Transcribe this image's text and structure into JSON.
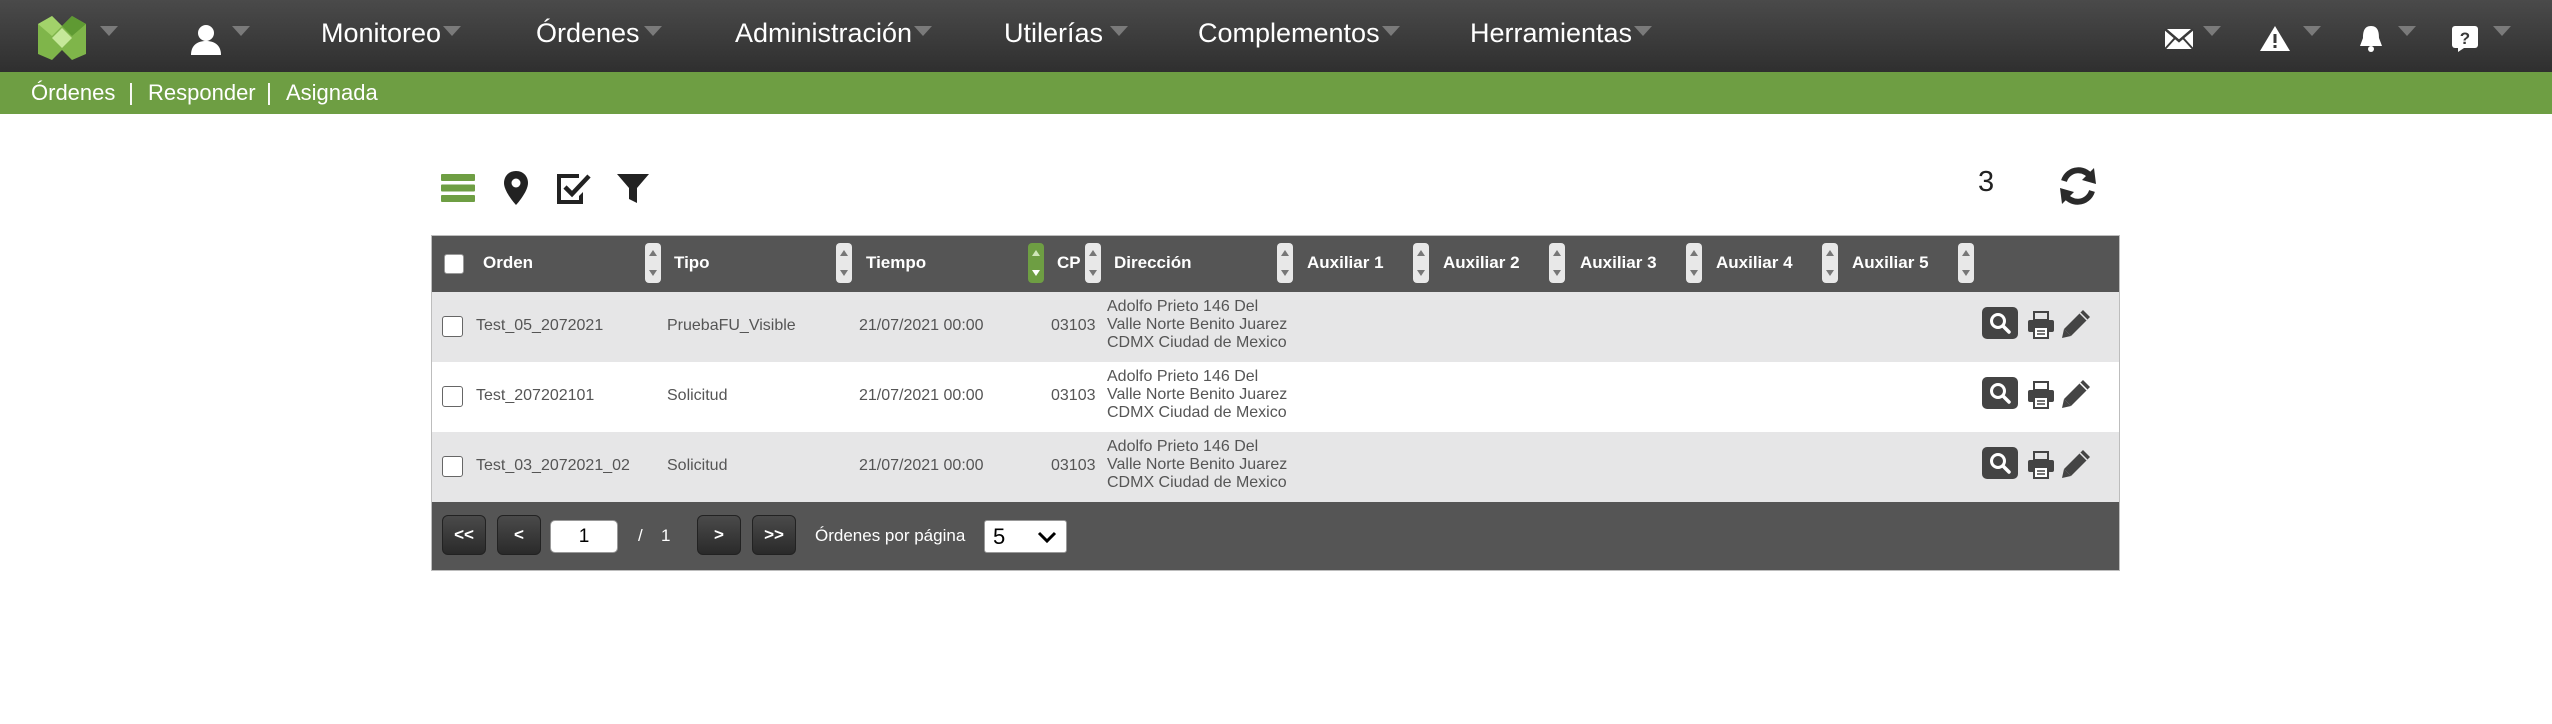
{
  "nav": {
    "menu": [
      "Monitoreo",
      "Órdenes",
      "Administración",
      "Utilerías",
      "Complementos",
      "Herramientas"
    ]
  },
  "breadcrumb": [
    "Órdenes",
    "Responder",
    "Asignada"
  ],
  "toolbar": {
    "record_count": "3"
  },
  "table": {
    "columns": [
      "Orden",
      "Tipo",
      "Tiempo",
      "CP",
      "Dirección",
      "Auxiliar 1",
      "Auxiliar 2",
      "Auxiliar 3",
      "Auxiliar 4",
      "Auxiliar 5"
    ],
    "rows": [
      {
        "orden": "Test_05_2072021",
        "tipo": "PruebaFU_Visible",
        "tiempo": "21/07/2021 00:00",
        "cp": "03103",
        "direccion": [
          "Adolfo Prieto 146 Del",
          "Valle Norte Benito Juarez",
          "CDMX Ciudad de Mexico"
        ]
      },
      {
        "orden": "Test_207202101",
        "tipo": "Solicitud",
        "tiempo": "21/07/2021 00:00",
        "cp": "03103",
        "direccion": [
          "Adolfo Prieto 146 Del",
          "Valle Norte Benito Juarez",
          "CDMX Ciudad de Mexico"
        ]
      },
      {
        "orden": "Test_03_2072021_02",
        "tipo": "Solicitud",
        "tiempo": "21/07/2021 00:00",
        "cp": "03103",
        "direccion": [
          "Adolfo Prieto 146 Del",
          "Valle Norte Benito Juarez",
          "CDMX Ciudad de Mexico"
        ]
      }
    ]
  },
  "pager": {
    "first": "<<",
    "prev": "<",
    "next": ">",
    "last": ">>",
    "current_page": "1",
    "of_label": "/",
    "total_pages": "1",
    "per_page_label": "Órdenes por página",
    "per_page_value": "5"
  },
  "colors": {
    "topbar": "#3a3a3a",
    "accent_green": "#6e9e43",
    "table_header": "#555555",
    "row_alt": "#e6e6e7"
  },
  "icons": {
    "nav": [
      "mail-icon",
      "alert-icon",
      "bell-icon",
      "help-icon"
    ],
    "toolbar": [
      "list-view-icon",
      "map-pin-icon",
      "check-document-icon",
      "filter-icon",
      "refresh-icon"
    ],
    "row_actions": [
      "search-icon",
      "print-icon",
      "edit-icon"
    ]
  }
}
